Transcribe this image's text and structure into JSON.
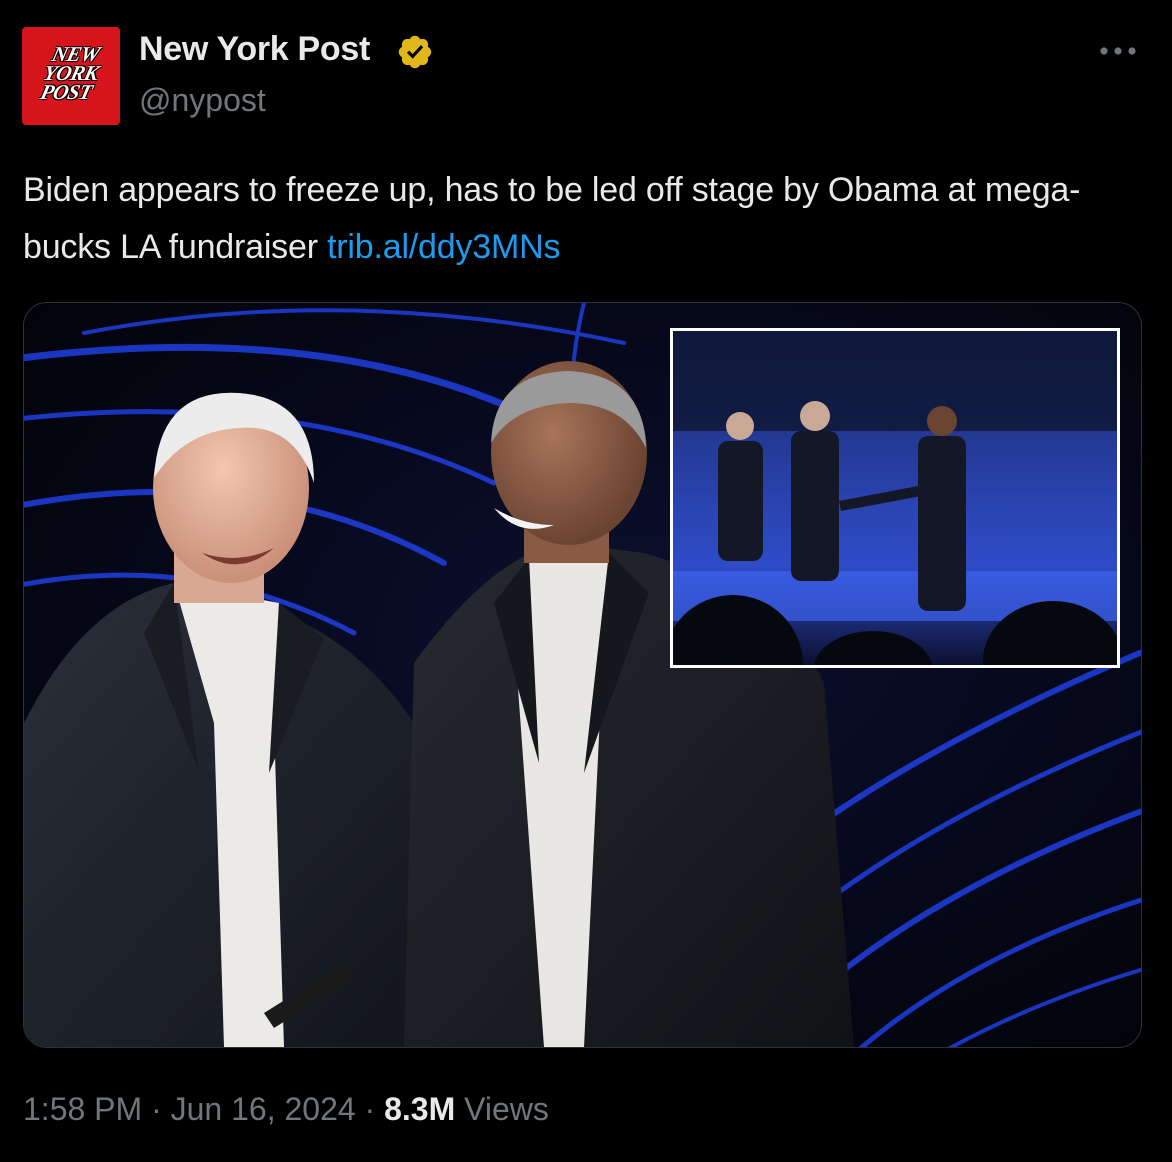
{
  "author": {
    "display_name": "New York Post",
    "handle": "@nypost",
    "avatar_text": [
      "NEW",
      "YORK",
      "POST"
    ],
    "verified": true,
    "verified_color": "#e2b719",
    "avatar_color": "#d6141c"
  },
  "tweet": {
    "text": "Biden appears to freeze up, has to be led off stage by Obama at mega-bucks LA fundraiser ",
    "link": "trib.al/ddy3MNs",
    "link_color": "#1d9bf0"
  },
  "media": {
    "type": "photo",
    "has_inset_photo": true
  },
  "meta": {
    "time": "1:58 PM",
    "separator1": " · ",
    "date": "Jun 16, 2024",
    "separator2": " · ",
    "views_count": "8.3M",
    "views_label": " Views"
  },
  "icons": {
    "more": "more-horizontal-icon",
    "verified": "verified-badge-icon"
  }
}
